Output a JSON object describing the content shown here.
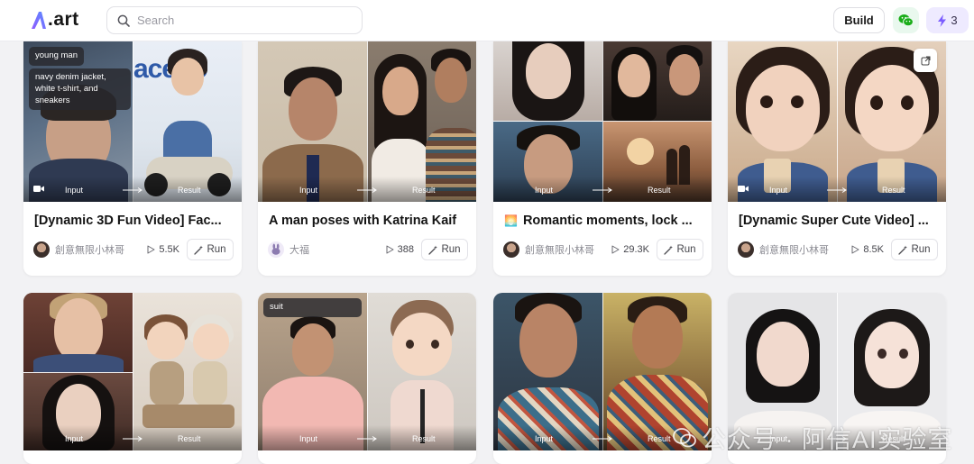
{
  "app": {
    "logo_text": ".art"
  },
  "header": {
    "search_placeholder": "Search",
    "build_label": "Build",
    "credits_count": "3"
  },
  "media_labels": {
    "input": "Input",
    "result": "Result"
  },
  "cards": [
    {
      "title": "[Dynamic 3D Fun Video] Fac...",
      "author": "創意無限小林哥",
      "views": "5.5K",
      "run_label": "Run",
      "is_video": true,
      "tags": [
        "young man",
        "navy denim jacket, white t-shirt, and sneakers"
      ]
    },
    {
      "title": "A man poses with Katrina Kaif",
      "author": "大福",
      "views": "388",
      "run_label": "Run",
      "is_video": false,
      "tags": []
    },
    {
      "title": "Romantic moments, lock ...",
      "author": "創意無限小林哥",
      "views": "29.3K",
      "run_label": "Run",
      "is_video": false,
      "tags": [],
      "title_emoji": "🌅"
    },
    {
      "title": "[Dynamic Super Cute Video] ...",
      "author": "創意無限小林哥",
      "views": "8.5K",
      "run_label": "Run",
      "is_video": true,
      "tags": []
    },
    {
      "is_video": false,
      "tags": []
    },
    {
      "is_video": false,
      "tags": [
        "suit"
      ]
    },
    {
      "is_video": false,
      "tags": []
    },
    {
      "is_video": false,
      "tags": []
    }
  ],
  "watermark": {
    "text": "公众号 · 阿信AI实验室"
  },
  "colors": {
    "accent": "#7b5cff",
    "wechat": "#1aad19",
    "card_bg": "#ffffff",
    "page_bg": "#f2f2f4"
  }
}
